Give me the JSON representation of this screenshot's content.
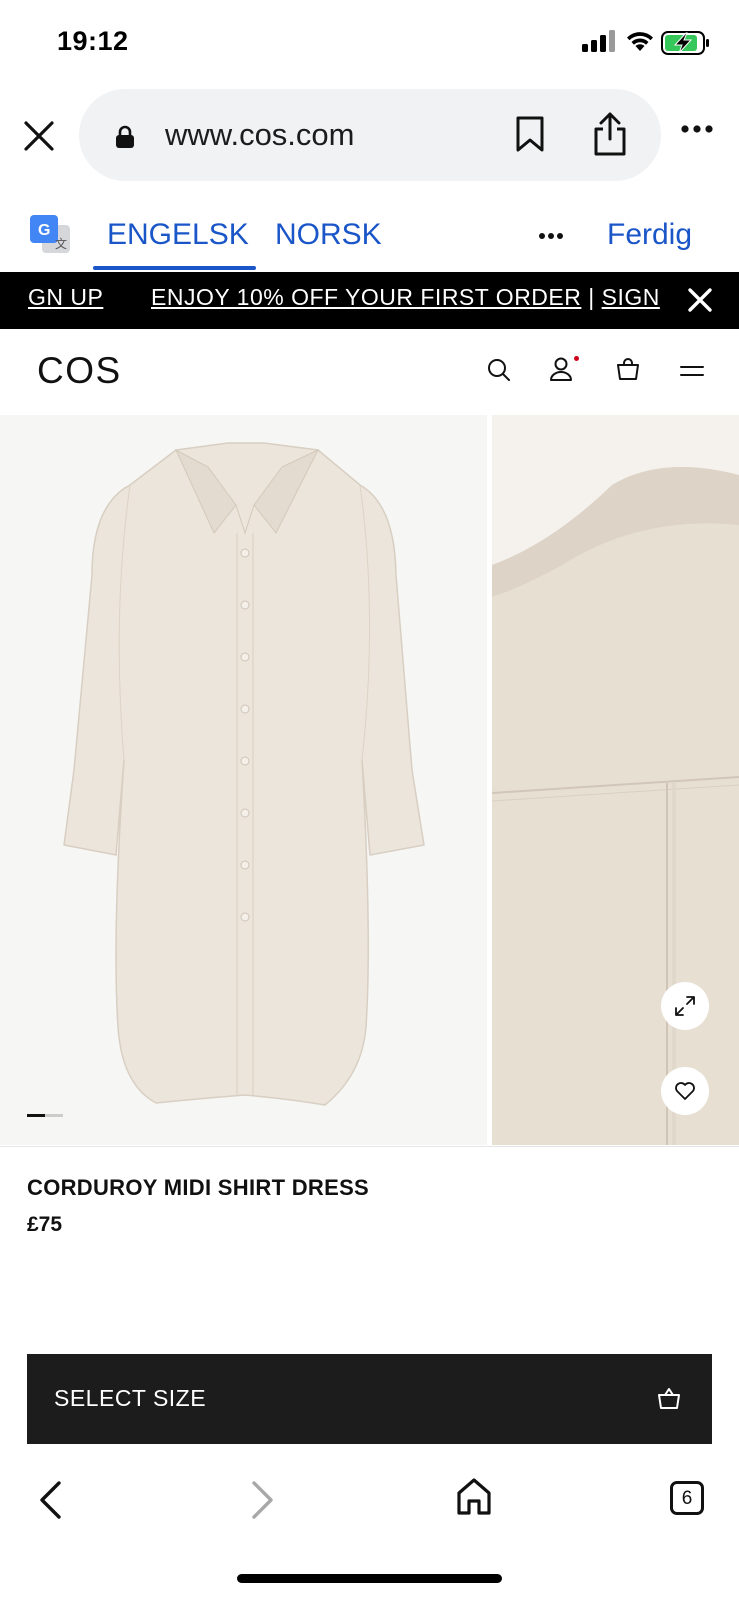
{
  "status_bar": {
    "time": "19:12"
  },
  "browser": {
    "url": "www.cos.com"
  },
  "translate_bar": {
    "source_lang": "ENGELSK",
    "target_lang": "NORSK",
    "done_label": "Ferdig"
  },
  "promo_banner": {
    "left_fragment": "GN UP",
    "offer_text": "ENJOY 10% OFF YOUR FIRST ORDER",
    "separator": " | ",
    "signup_fragment": "SIGN"
  },
  "site_header": {
    "logo": "COS"
  },
  "gallery": {
    "current_slide": 1,
    "slide_count": 2,
    "background_color": "#f6f6f5",
    "dress_color": "#ece5db"
  },
  "product": {
    "name": "CORDUROY MIDI SHIRT DRESS",
    "price": "£75"
  },
  "cta": {
    "select_size_label": "SELECT SIZE"
  },
  "toolbar": {
    "tab_count": "6"
  },
  "colors": {
    "link_blue": "#1a56c8",
    "banner_bg": "#000000",
    "cta_bg": "#1c1c1c"
  }
}
